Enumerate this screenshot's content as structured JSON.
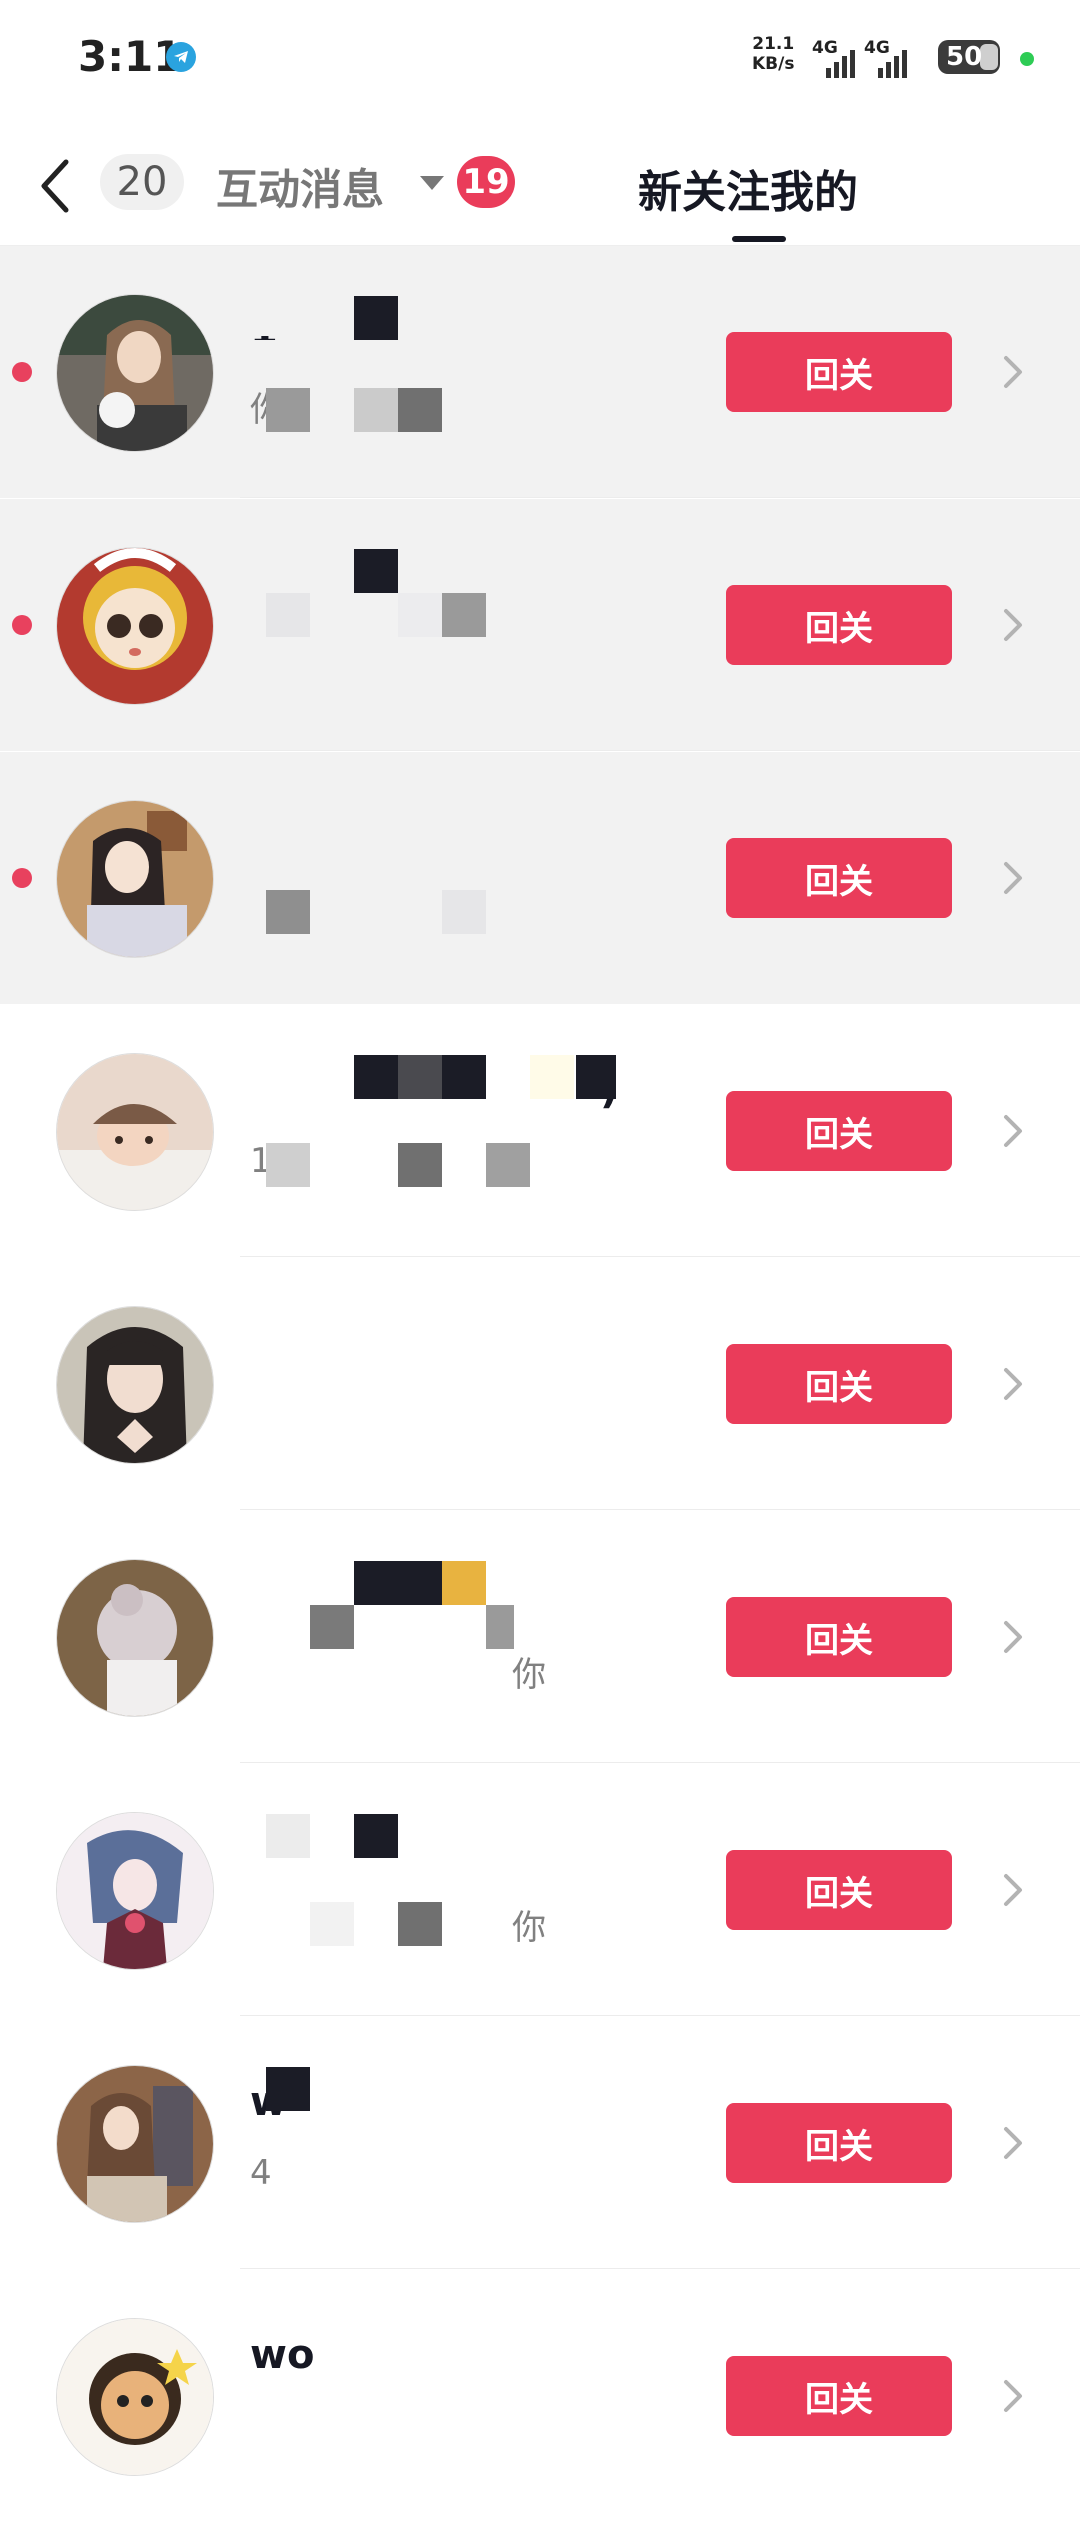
{
  "status_bar": {
    "time": "3:11",
    "net_speed_value": "21.1",
    "net_speed_unit": "KB/s",
    "signal1_label": "4G",
    "signal2_label": "4G",
    "battery": "50"
  },
  "header": {
    "conversation_count": "20",
    "interaction_tab": "互动消息",
    "interaction_badge": "19",
    "active_tab": "新关注我的"
  },
  "followers": [
    {
      "name": "1",
      "subtitle": "你",
      "action": "回关",
      "unread": true
    },
    {
      "name": "",
      "subtitle": "",
      "action": "回关",
      "unread": true
    },
    {
      "name": "",
      "subtitle": "",
      "action": "回关",
      "unread": true
    },
    {
      "name": ")",
      "subtitle": "1",
      "action": "回关",
      "unread": false
    },
    {
      "name": "",
      "subtitle": "",
      "action": "回关",
      "unread": false
    },
    {
      "name": "",
      "subtitle": "你",
      "action": "回关",
      "unread": false
    },
    {
      "name": "",
      "subtitle": "你",
      "action": "回关",
      "unread": false
    },
    {
      "name": "w",
      "subtitle": "4",
      "action": "回关",
      "unread": false
    },
    {
      "name": "wo",
      "subtitle": "",
      "action": "回关",
      "unread": false
    }
  ],
  "colors": {
    "accent": "#ea3c5a",
    "unread_background": "#f2f2f2",
    "text_primary": "#161823"
  },
  "icons": {
    "back": "chevron-left-icon",
    "row_chevron": "chevron-right-icon",
    "caret": "caret-down-icon",
    "telegram": "telegram-icon"
  }
}
